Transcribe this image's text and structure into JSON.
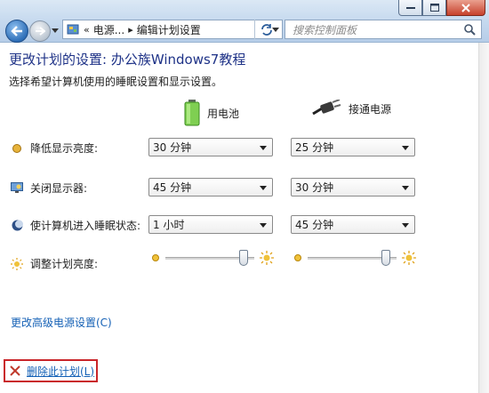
{
  "nav": {
    "address_segments": [
      "«",
      "电源...",
      "编辑计划设置"
    ],
    "search_placeholder": "搜索控制面板"
  },
  "page": {
    "title": "更改计划的设置: 办公族Windows7教程",
    "subtitle": "选择希望计算机使用的睡眠设置和显示设置。"
  },
  "columns": {
    "battery": "用电池",
    "plugged_in": "接通电源"
  },
  "settings": [
    {
      "label": "降低显示亮度:",
      "icon": "dim-display-icon",
      "battery": "30 分钟",
      "plugged_in": "25 分钟"
    },
    {
      "label": "关闭显示器:",
      "icon": "monitor-off-icon",
      "battery": "45 分钟",
      "plugged_in": "30 分钟"
    },
    {
      "label": "使计算机进入睡眠状态:",
      "icon": "sleep-moon-icon",
      "battery": "1 小时",
      "plugged_in": "45 分钟"
    }
  ],
  "brightness": {
    "label": "调整计划亮度:",
    "battery_level": 0.92,
    "plugged_in_level": 0.92
  },
  "links": {
    "advanced": "更改高级电源设置(C)",
    "delete": "删除此计划(L)"
  },
  "colors": {
    "title_blue": "#1e3287",
    "link_blue": "#1561b6",
    "highlight_red": "#c9252a"
  }
}
